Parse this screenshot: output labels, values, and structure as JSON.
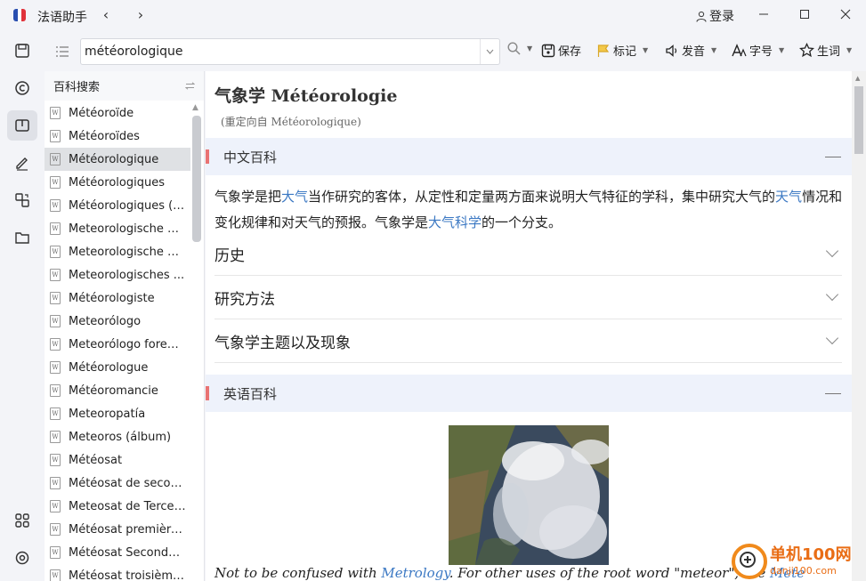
{
  "app": {
    "title": "法语助手"
  },
  "titlebar": {
    "login_label": "登录",
    "back": "‹",
    "forward": "›"
  },
  "search": {
    "value": "météorologique",
    "placeholder": ""
  },
  "toolbar": {
    "save_label": "保存",
    "mark_label": "标记",
    "pronounce_label": "发音",
    "font_label": "字号",
    "vocab_label": "生词"
  },
  "sidebar": {
    "header": "百科搜索",
    "items": [
      {
        "label": "Météoroïde"
      },
      {
        "label": "Météoroïdes"
      },
      {
        "label": "Météorologique"
      },
      {
        "label": "Météorologiques"
      },
      {
        "label": "Météorologiques (A..."
      },
      {
        "label": "Meteorologische A..."
      },
      {
        "label": "Meteorologische Si..."
      },
      {
        "label": "Meteorologisches ..."
      },
      {
        "label": "Météorologiste"
      },
      {
        "label": "Meteorólogo"
      },
      {
        "label": "Meteorólogo forense"
      },
      {
        "label": "Météorologue"
      },
      {
        "label": "Météoromancie"
      },
      {
        "label": "Meteoropatía"
      },
      {
        "label": "Meteoros (álbum)"
      },
      {
        "label": "Météosat"
      },
      {
        "label": "Météosat de secon..."
      },
      {
        "label": "Meteosat de Tercer..."
      },
      {
        "label": "Météosat première ..."
      },
      {
        "label": "Météosat Seconde ..."
      },
      {
        "label": "Météosat troisième ..."
      }
    ],
    "active_index": 2
  },
  "content": {
    "title": "气象学 Météorologie",
    "redirect": "(重定向自 Météorologique)",
    "section_cn": {
      "title": "中文百科"
    },
    "para": {
      "t1": "气象学是把",
      "l1": "大气",
      "t2": "当作研究的客体，从定性和定量两方面来说明大气特征的学科，集中研究大气的",
      "l2": "天气",
      "t3": "情况和变化规律和对天气的预报。气象学是",
      "l3": "大气科学",
      "t4": "的一个分支。"
    },
    "accordions": [
      {
        "label": "历史"
      },
      {
        "label": "研究方法"
      },
      {
        "label": "气象学主题以及现象"
      }
    ],
    "section_en": {
      "title": "英语百科"
    },
    "note": {
      "t1": "Not to be confused with ",
      "l1": "Metrology",
      "t2": ". For other uses of the root word \"meteor\", see ",
      "l2": "Mete"
    }
  },
  "watermark": {
    "cn": "单机100网",
    "url": "danji100.com"
  },
  "colors": {
    "accent_link": "#3b78c3",
    "section_mark": "#e97373",
    "section_bg": "#eef2fb",
    "watermark": "#e96d15"
  }
}
